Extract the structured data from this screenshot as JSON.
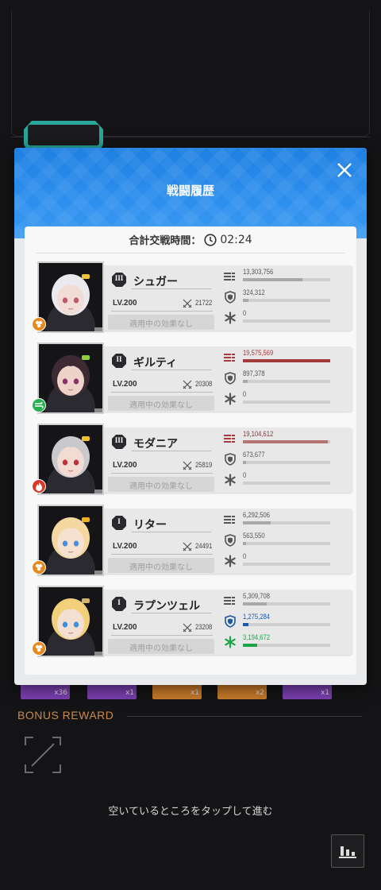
{
  "modal": {
    "title": "戦闘履歴",
    "total_time_label": "合計交戦時間：",
    "total_time_value": "02:24"
  },
  "characters": [
    {
      "name": "シュガー",
      "burst": "III",
      "level": "LV.200",
      "power": "21722",
      "effect": "適用中の効果なし",
      "element_color": "#e8891e",
      "damage": "13,303,756",
      "damage_ratio": 0.68,
      "damage_taken": "324,312",
      "damage_taken_ratio": 0.06,
      "heal": "0",
      "heal_ratio": 0,
      "highlight": "none"
    },
    {
      "name": "ギルティ",
      "burst": "II",
      "level": "LV.200",
      "power": "20308",
      "effect": "適用中の効果なし",
      "element_color": "#22b14c",
      "damage": "19,575,569",
      "damage_ratio": 1.0,
      "damage_taken": "897,378",
      "damage_taken_ratio": 0.05,
      "heal": "0",
      "heal_ratio": 0,
      "highlight": "damage"
    },
    {
      "name": "モダニア",
      "burst": "III",
      "level": "LV.200",
      "power": "25819",
      "effect": "適用中の効果なし",
      "element_color": "#d83a2a",
      "damage": "19,104,612",
      "damage_ratio": 0.97,
      "damage_taken": "673,677",
      "damage_taken_ratio": 0.04,
      "heal": "0",
      "heal_ratio": 0,
      "highlight": "damage-soft"
    },
    {
      "name": "リター",
      "burst": "I",
      "level": "LV.200",
      "power": "24491",
      "effect": "適用中の効果なし",
      "element_color": "#e8891e",
      "damage": "6,292,506",
      "damage_ratio": 0.32,
      "damage_taken": "563,550",
      "damage_taken_ratio": 0.04,
      "heal": "0",
      "heal_ratio": 0,
      "highlight": "none"
    },
    {
      "name": "ラプンツェル",
      "burst": "I",
      "level": "LV.200",
      "power": "23208",
      "effect": "適用中の効果なし",
      "element_color": "#e8891e",
      "damage": "5,309,708",
      "damage_ratio": 0.27,
      "damage_taken": "1,275,284",
      "damage_taken_ratio": 0.06,
      "heal": "3,194,672",
      "heal_ratio": 0.16,
      "highlight": "support"
    }
  ],
  "colors": {
    "damage_strong": "#a33a3c",
    "damage_soft": "#b57472",
    "damage_normal": "#a9a9ab",
    "taken_normal": "#a9a9ab",
    "taken_strong": "#1f5aa3",
    "heal_strong": "#1fa34a",
    "heal_normal": "#a9a9ab"
  },
  "background": {
    "items": [
      "x36",
      "x1",
      "x1",
      "x2",
      "x1"
    ],
    "bonus_reward_title": "BONUS REWARD",
    "tap_hint": "空いているところをタップして進む"
  }
}
